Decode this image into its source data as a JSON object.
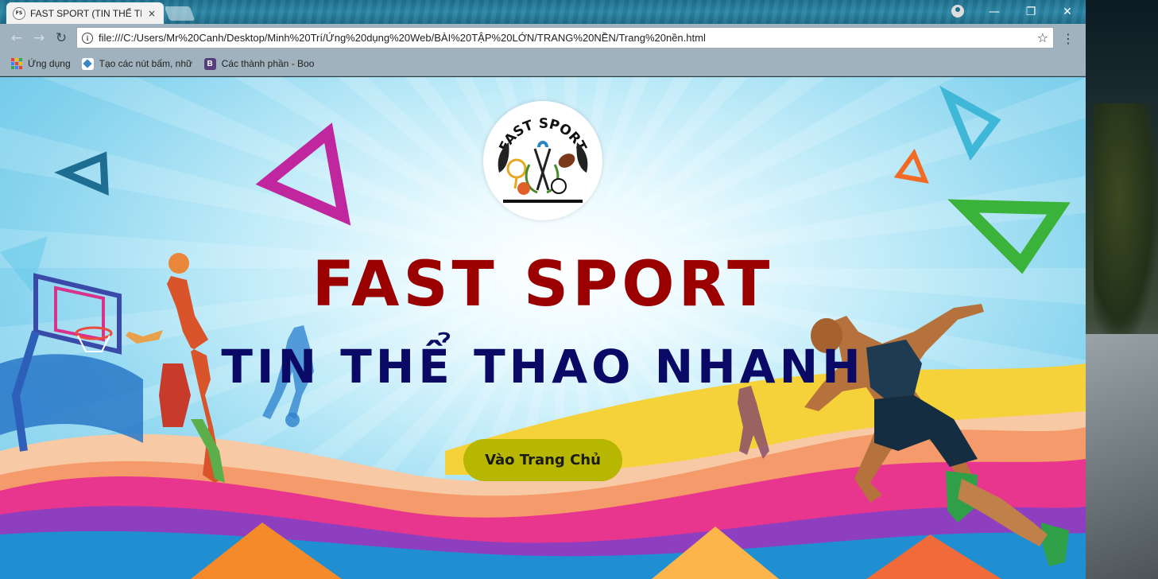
{
  "browser": {
    "tab_title": "FAST SPORT (TIN THỂ TH",
    "tab_close": "×",
    "url": "file:///C:/Users/Mr%20Canh/Desktop/Minh%20Trí/Ứng%20dụng%20Web/BÀI%20TẬP%20LỚN/TRANG%20NỀN/Trang%20nền.html",
    "bookmarks": {
      "apps": "Ứng dụng",
      "item1": "Tạo các nút bấm, nhữ",
      "item2": "Các thành phần - Boo"
    },
    "window_controls": {
      "minimize": "—",
      "maximize": "❐",
      "close": "✕"
    }
  },
  "page": {
    "logo_text": "FAST SPORT",
    "title": "FAST SPORT",
    "subtitle": "TIN THỂ THAO NHANH",
    "cta_label": "Vào Trang Chủ"
  },
  "colors": {
    "title": "#9b0000",
    "subtitle": "#0a0a66",
    "cta_background": "#b7b600"
  }
}
